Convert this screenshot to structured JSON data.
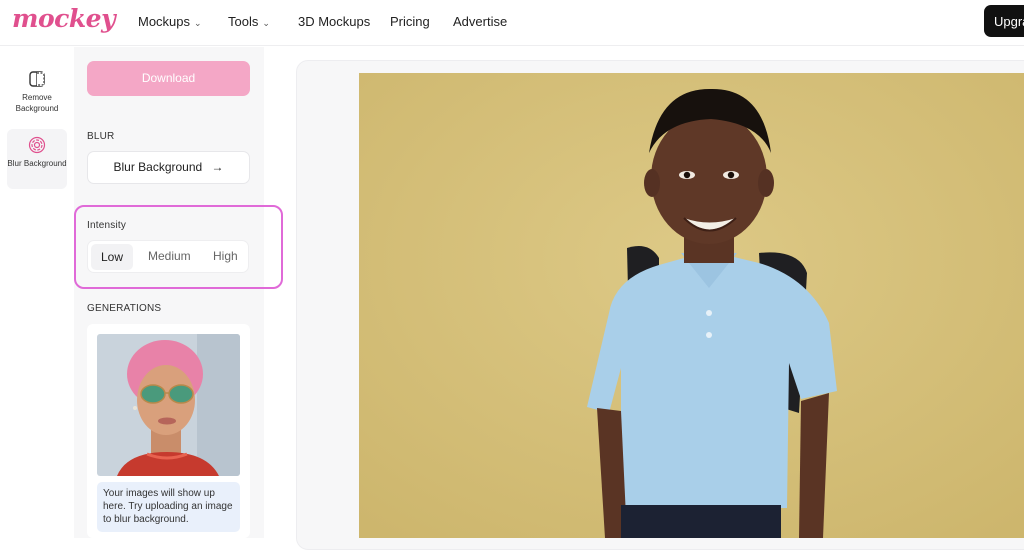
{
  "brand": {
    "logo_text": "mockey",
    "color": "#e0508e"
  },
  "nav": {
    "items": [
      {
        "label": "Mockups",
        "has_dropdown": true
      },
      {
        "label": "Tools",
        "has_dropdown": true
      },
      {
        "label": "3D Mockups",
        "has_dropdown": false
      },
      {
        "label": "Pricing",
        "has_dropdown": false
      },
      {
        "label": "Advertise",
        "has_dropdown": false
      }
    ],
    "upgrade_label": "Upgra"
  },
  "rail": {
    "items": [
      {
        "label": "Remove Background",
        "icon": "remove-background-icon",
        "active": false
      },
      {
        "label": "Blur Background",
        "icon": "blur-icon",
        "active": true
      }
    ]
  },
  "panel": {
    "download_label": "Download",
    "blur_section_label": "BLUR",
    "blur_button_label": "Blur Background",
    "arrow": "→",
    "intensity_label": "Intensity",
    "intensity_options": [
      "Low",
      "Medium",
      "High"
    ],
    "intensity_selected": "Low",
    "generations_label": "GENERATIONS",
    "generations_note": "Your images will show up here. Try uploading an image to blur background."
  },
  "colors": {
    "accent": "#e0508e",
    "download_bg": "#f4a7c6",
    "highlight_border": "#e06ad8",
    "photo_wall": "#d8c47a"
  }
}
